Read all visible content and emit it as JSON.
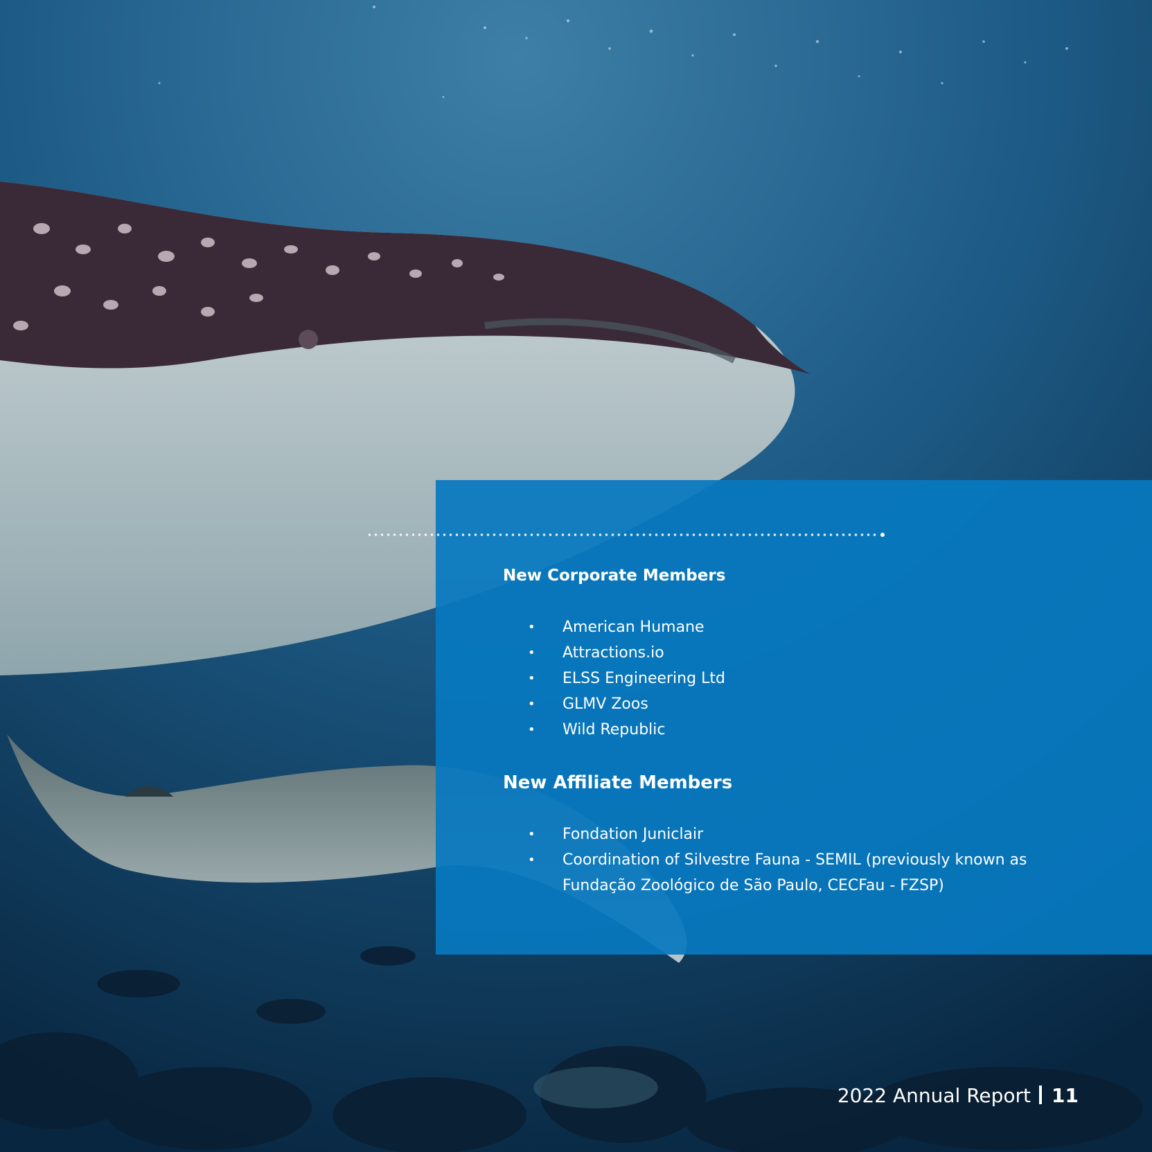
{
  "corporate": {
    "heading": "New Corporate Members",
    "items": [
      "American Humane",
      "Attractions.io",
      "ELSS Engineering Ltd",
      "GLMV Zoos",
      "Wild Republic"
    ]
  },
  "affiliate": {
    "heading": "New Affiliate Members",
    "items": [
      "Fondation Juniclair",
      "Coordination of Silvestre Fauna - SEMIL (previously known as Fundação Zoológico de São Paulo, CECFau - FZSP)"
    ]
  },
  "footer": {
    "report_title": "2022 Annual Report",
    "page_number": "11"
  },
  "colors": {
    "panel": "#0778c0",
    "ocean_dark": "#0b2e4e",
    "ocean_light": "#2f6f96",
    "text": "#ffffff"
  },
  "bullet_glyph": "•"
}
